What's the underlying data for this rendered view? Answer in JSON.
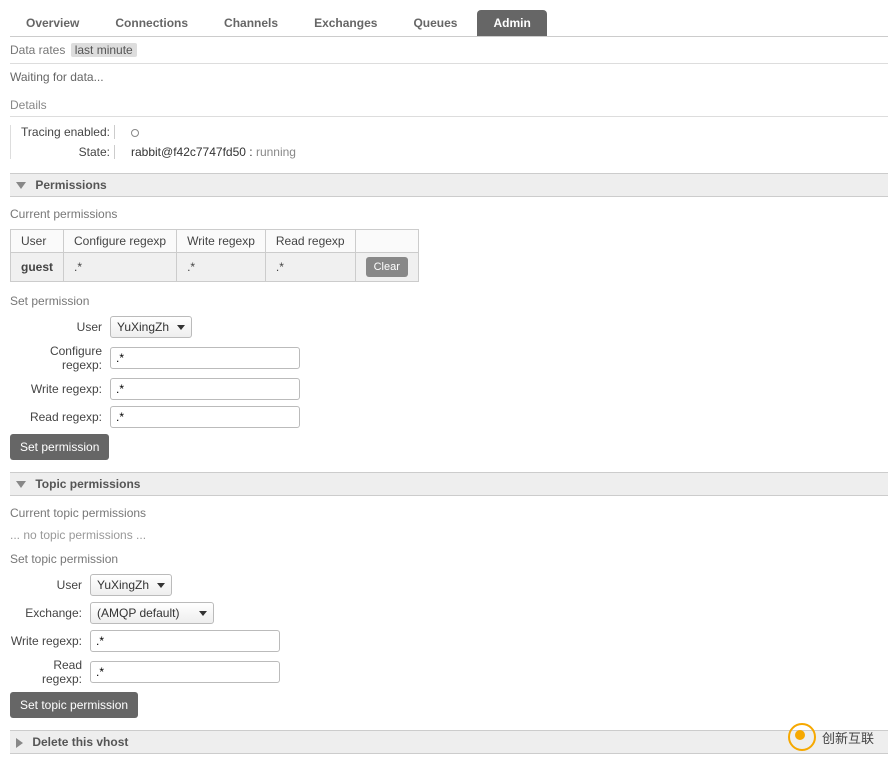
{
  "tabs": {
    "items": [
      "Overview",
      "Connections",
      "Channels",
      "Exchanges",
      "Queues",
      "Admin"
    ],
    "active_index": 5
  },
  "data_rates": {
    "label": "Data rates",
    "range": "last minute"
  },
  "waiting": "Waiting for data...",
  "details": {
    "title": "Details",
    "tracing_label": "Tracing enabled:",
    "state_label": "State:",
    "node": "rabbit@f42c7747fd50",
    "sep": " : ",
    "state": "running"
  },
  "permissions": {
    "header": "Permissions",
    "current_title": "Current permissions",
    "columns": [
      "User",
      "Configure regexp",
      "Write regexp",
      "Read regexp"
    ],
    "rows": [
      {
        "user": "guest",
        "configure": ".*",
        "write": ".*",
        "read": ".*",
        "clear": "Clear"
      }
    ],
    "set_title": "Set permission",
    "form": {
      "user_label": "User",
      "user_value": "YuXingZh",
      "configure_label": "Configure regexp:",
      "configure_value": ".*",
      "write_label": "Write regexp:",
      "write_value": ".*",
      "read_label": "Read regexp:",
      "read_value": ".*",
      "submit": "Set permission"
    }
  },
  "topic_permissions": {
    "header": "Topic permissions",
    "current_title": "Current topic permissions",
    "empty": "... no topic permissions ...",
    "set_title": "Set topic permission",
    "form": {
      "user_label": "User",
      "user_value": "YuXingZh",
      "exchange_label": "Exchange:",
      "exchange_value": "(AMQP default)",
      "write_label": "Write regexp:",
      "write_value": ".*",
      "read_label": "Read regexp:",
      "read_value": ".*",
      "submit": "Set topic permission"
    }
  },
  "delete_vhost": {
    "header": "Delete this vhost"
  },
  "watermark": "创新互联"
}
